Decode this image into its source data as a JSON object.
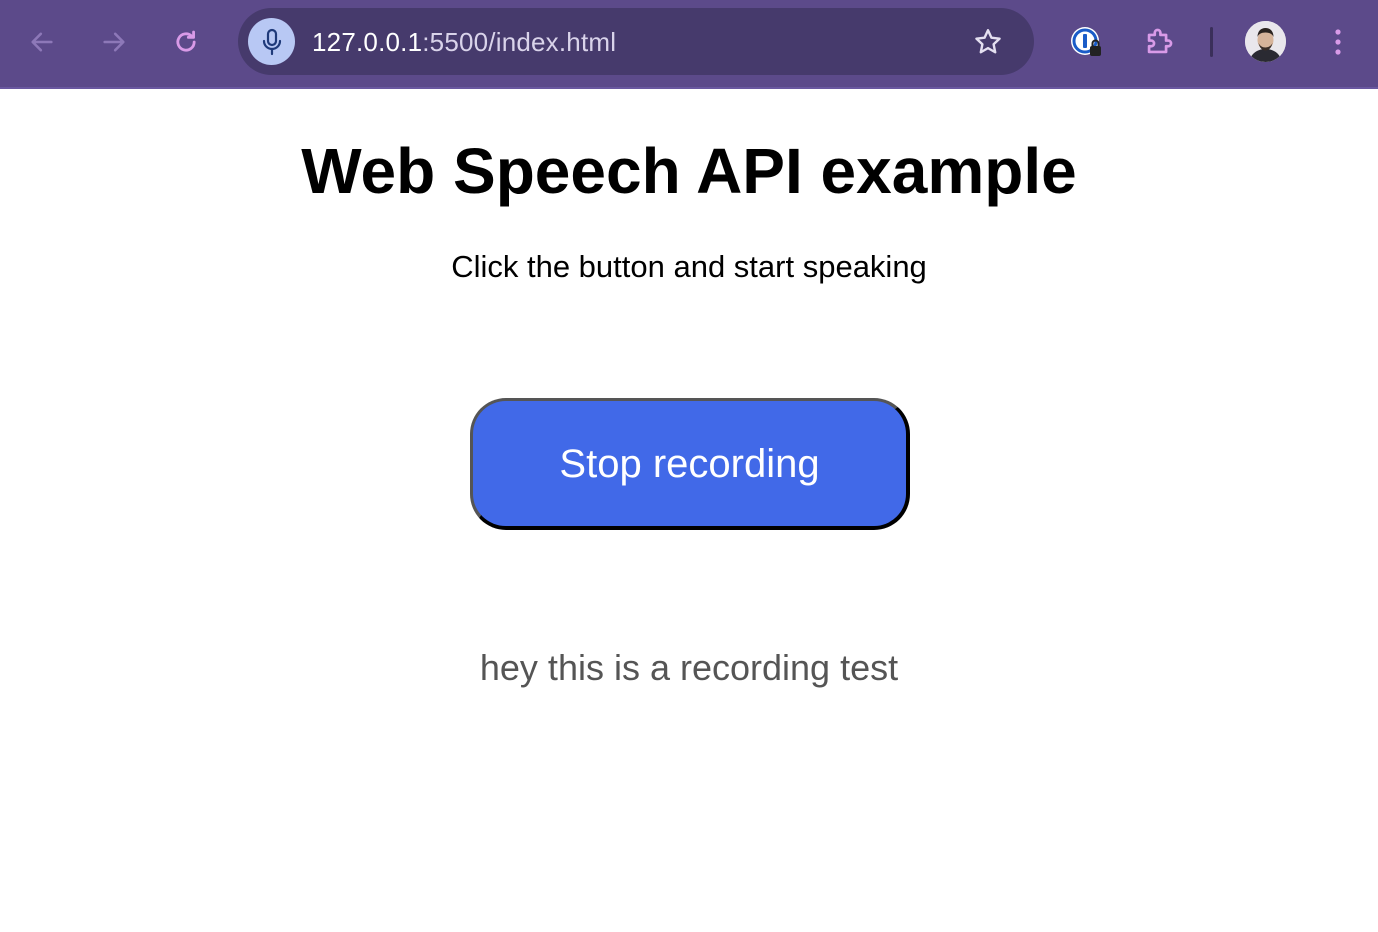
{
  "browser": {
    "url_host": "127.0.0.1",
    "url_rest": ":5500/index.html",
    "icons": {
      "back": "arrow-left-icon",
      "forward": "arrow-right-icon",
      "reload": "reload-icon",
      "mic": "microphone-icon",
      "bookmark": "star-icon",
      "password_manager": "password-manager-icon",
      "extensions": "puzzle-icon",
      "menu": "kebab-menu-icon"
    },
    "colors": {
      "toolbar": "#5c4a8a",
      "omnibox": "#463a6c",
      "mic_badge": "#b8c8f4"
    }
  },
  "page": {
    "title": "Web Speech API example",
    "subtitle": "Click the button and start speaking",
    "record_button_label": "Stop recording",
    "transcript": "hey this is a recording test",
    "colors": {
      "button_bg": "#4169e8",
      "button_text": "#ffffff",
      "transcript_text": "#555555"
    }
  }
}
